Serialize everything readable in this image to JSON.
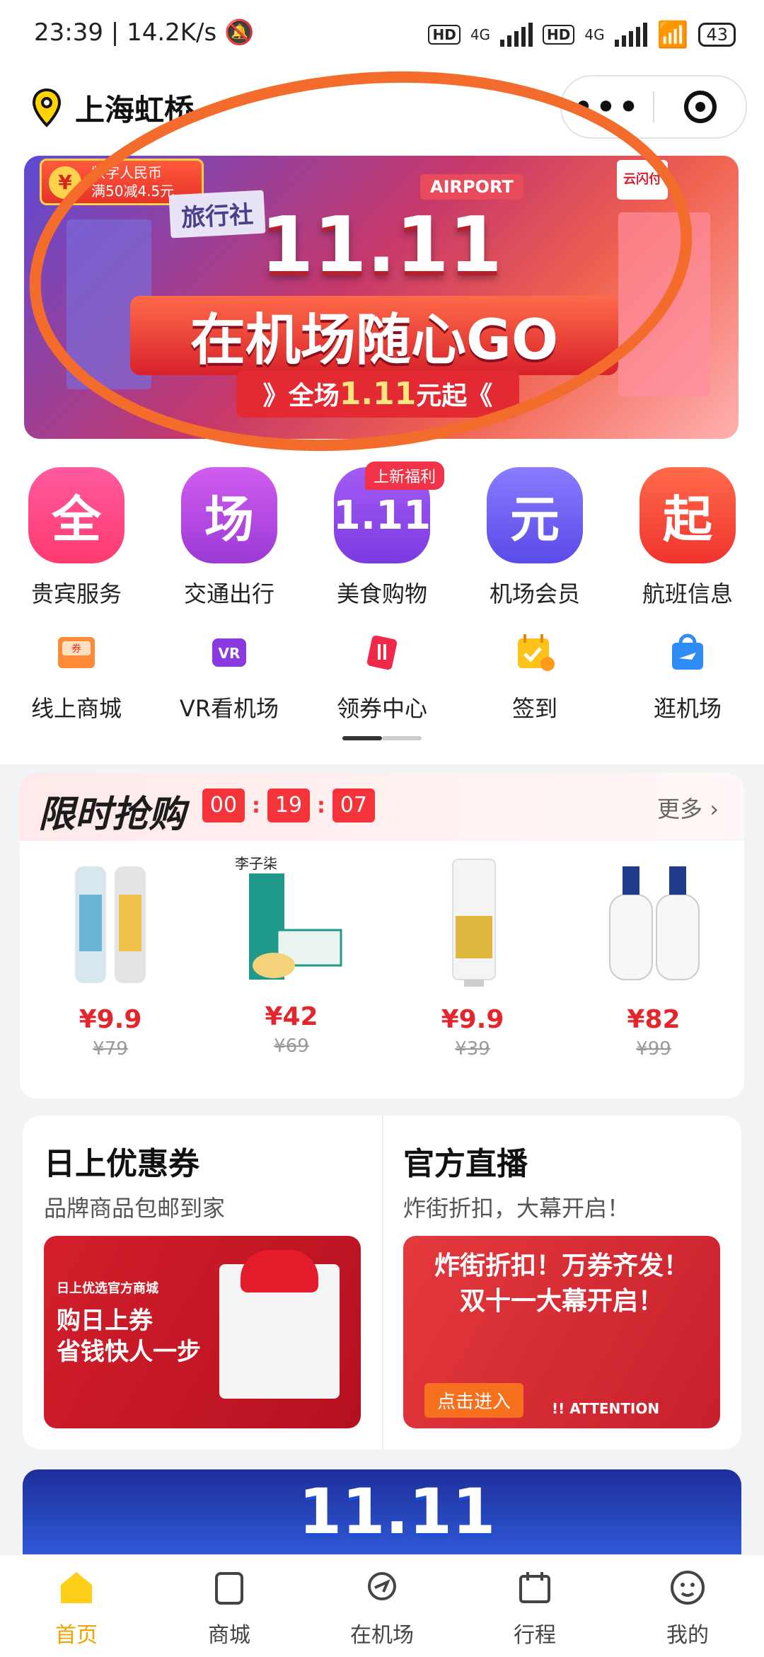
{
  "status_bar": {
    "time": "23:39",
    "speed": "14.2K/s",
    "network1": "HD",
    "network2": "HD",
    "sig1": "4G",
    "sig2": "4G",
    "battery": "43"
  },
  "header": {
    "city": "上海虹桥",
    "chevron": "chevron-down-icon"
  },
  "banner": {
    "coupon_line1": "数字人民币",
    "coupon_line2": "满50减4.5元",
    "travel_sign": "旅行社",
    "airport_sign": "AIRPORT",
    "pay_sign": "云闪付",
    "headline": "11.11",
    "slogan": "在机场随心GO",
    "sub_prefix": "》全场",
    "sub_price": "1.11",
    "sub_suffix": "元起《"
  },
  "icons_row1": [
    {
      "glyph": "全",
      "label": "贵宾服务",
      "color": "#ff4d8f"
    },
    {
      "glyph": "场",
      "label": "交通出行",
      "color": "#b24de0"
    },
    {
      "glyph": "1.11",
      "label": "美食购物",
      "color": "#8a4de8"
    },
    {
      "glyph": "元",
      "label": "机场会员",
      "color": "#6a5cf0"
    },
    {
      "glyph": "起",
      "label": "航班信息",
      "color": "#ff4d3a"
    }
  ],
  "icons_row1_tag": "上新福利",
  "icons_row2": [
    {
      "label": "线上商城",
      "icon": "coupon-icon"
    },
    {
      "label": "VR看机场",
      "icon": "vr-icon"
    },
    {
      "label": "领券中心",
      "icon": "ticket-icon"
    },
    {
      "label": "签到",
      "icon": "calendar-checkin-icon"
    },
    {
      "label": "逛机场",
      "icon": "shopping-bag-plane-icon"
    }
  ],
  "flash_sale": {
    "title": "限时抢购",
    "timer": {
      "h": "00",
      "m": "19",
      "s": "07"
    },
    "more": "更多",
    "products": [
      {
        "price": "¥9.9",
        "original": "¥79",
        "name": "spray-can-product"
      },
      {
        "price": "¥42",
        "original": "¥69",
        "name": "tea-box-product"
      },
      {
        "price": "¥9.9",
        "original": "¥39",
        "name": "toothpaste-product"
      },
      {
        "price": "¥82",
        "original": "¥99",
        "name": "dove-cleanser-product"
      }
    ],
    "tea_brand": "李子柒"
  },
  "cards": {
    "left": {
      "title": "日上优惠券",
      "subtitle": "品牌商品包邮到家",
      "img_line1": "日上优选官方商城",
      "img_line2": "购日上券",
      "img_line3": "省钱快人一步"
    },
    "right": {
      "title": "官方直播",
      "subtitle": "炸街折扣，大幕开启！",
      "img_line1": "炸街折扣！万券齐发！",
      "img_line2": "双十一大幕开启！",
      "button": "点击进入",
      "attention": "!! ATTENTION"
    }
  },
  "bottom_banner": {
    "headline": "11.11"
  },
  "tabbar": [
    {
      "label": "首页",
      "icon": "home-icon",
      "active": true
    },
    {
      "label": "商城",
      "icon": "shop-icon",
      "active": false
    },
    {
      "label": "在机场",
      "icon": "airport-icon",
      "active": false
    },
    {
      "label": "行程",
      "icon": "calendar-icon",
      "active": false
    },
    {
      "label": "我的",
      "icon": "profile-icon",
      "active": false
    }
  ],
  "colors": {
    "accent": "#f3a200",
    "sale_red": "#f5333a",
    "annotation_orange": "#f36c2c"
  }
}
